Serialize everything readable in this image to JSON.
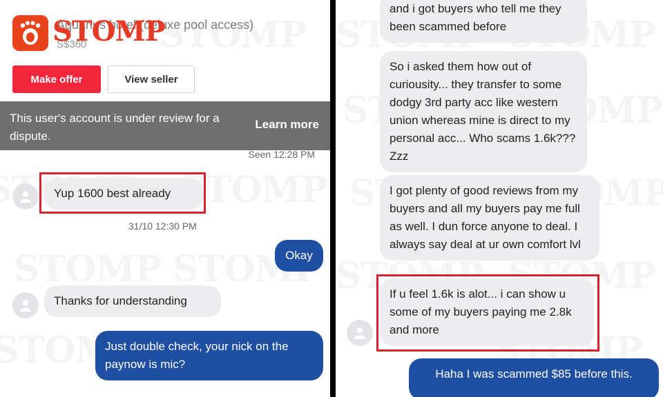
{
  "brand": {
    "name": "STOMP",
    "watermark": "STOMP"
  },
  "listing": {
    "title": "Aquarius hotel (deluxe pool access)",
    "price": "S$360"
  },
  "buttons": {
    "make_offer": "Make offer",
    "view_seller": "View seller"
  },
  "banner": {
    "text": "This user's account is under review for a dispute.",
    "link": "Learn more"
  },
  "left_chat": {
    "seen": "Seen 12:28 PM",
    "msg1": "Yup 1600 best already",
    "ts1": "31/10 12:30 PM",
    "msg2": "Okay",
    "msg3": "Thanks for understanding",
    "msg4": "Just double check, your nick on the paynow is mic?"
  },
  "right_chat": {
    "msg1": "and i got buyers who tell me they been scammed before",
    "msg2": "So i asked them how out of curiousity... they transfer to some dodgy 3rd party acc like western union whereas mine is direct to my personal acc... Who scams 1.6k??? Zzz",
    "msg3": "I got plenty of good reviews from my buyers and all my buyers pay me full as well. I dun force anyone to deal. I always say deal at ur own comfort lvl",
    "msg4": "If u feel 1.6k is alot... i can show u some of my buyers paying me 2.8k and more",
    "msg5": "Haha I was scammed $85 before this."
  },
  "colors": {
    "accent_red": "#f0263d",
    "outgoing_blue": "#1f4fa3",
    "incoming_gray": "#ededef",
    "highlight": "#d9202e"
  }
}
